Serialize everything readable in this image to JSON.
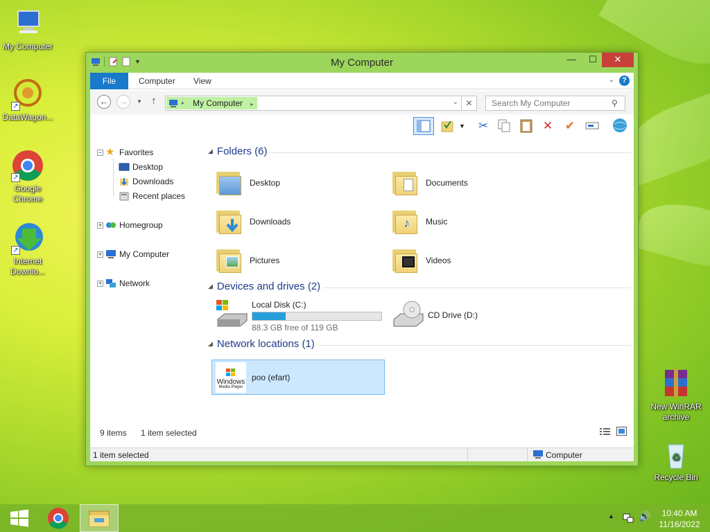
{
  "desktop": {
    "icons": [
      {
        "label": "My Computer"
      },
      {
        "label": "DataWagon..."
      },
      {
        "label": "Google Chrome"
      },
      {
        "label": "Internet Downlo..."
      },
      {
        "label": "New WinRAR archive"
      },
      {
        "label": "Recycle Bin"
      }
    ]
  },
  "window": {
    "title": "My Computer",
    "min_glyph": "—",
    "max_glyph": "☐",
    "close_glyph": "✕",
    "ribbon_tabs": [
      "File",
      "Computer",
      "View"
    ],
    "address": {
      "crumb": "My Computer"
    },
    "search": {
      "placeholder": "Search My Computer"
    },
    "nav": {
      "favorites": "Favorites",
      "favorites_items": [
        "Desktop",
        "Downloads",
        "Recent places"
      ],
      "homegroup": "Homegroup",
      "my_computer": "My Computer",
      "network": "Network"
    },
    "groups": {
      "folders": "Folders (6)",
      "devices": "Devices and drives (2)",
      "network": "Network locations (1)"
    },
    "folders": [
      "Desktop",
      "Documents",
      "Downloads",
      "Music",
      "Pictures",
      "Videos"
    ],
    "drives": [
      {
        "name": "Local Disk (C:)",
        "free": "88.3 GB free of 119 GB",
        "used_fraction": 0.26
      },
      {
        "name": "CD Drive (D:)"
      }
    ],
    "network_locations": [
      {
        "name": "poo (efart)",
        "logo_text_1": "Windows",
        "logo_text_2": "Media Player"
      }
    ],
    "status": {
      "items": "9 items",
      "selected": "1 item selected"
    },
    "details_bar": {
      "selected": "1 item selected",
      "location": "Computer"
    }
  },
  "taskbar": {
    "time": "10:40 AM",
    "date": "11/16/2022"
  },
  "colors": {
    "accent": "#1979ca",
    "title_bar": "#9cd65a",
    "selection": "#cce8ff"
  }
}
